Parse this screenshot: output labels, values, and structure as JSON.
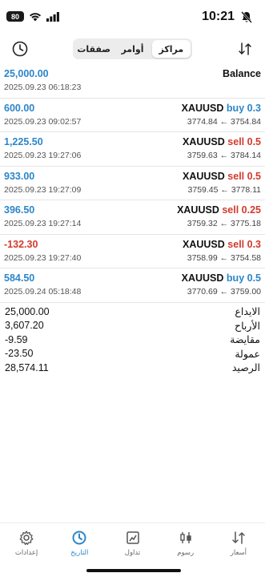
{
  "status_bar": {
    "battery": "80",
    "time": "10:21"
  },
  "segments": [
    {
      "label": "صفقات",
      "active": false
    },
    {
      "label": "أوامر",
      "active": false
    },
    {
      "label": "مراكز",
      "active": true
    }
  ],
  "balance_row": {
    "amount": "25,000.00",
    "date": "2025.09.23 06:18:23",
    "label": "Balance"
  },
  "trades": [
    {
      "profit": "600.00",
      "date": "2025.09.23 09:02:57",
      "symbol": "XAUUSD",
      "side": "buy 0.3",
      "prices": "3774.84 ← 3754.84"
    },
    {
      "profit": "1,225.50",
      "date": "2025.09.23 19:27:06",
      "symbol": "XAUUSD",
      "side": "sell 0.5",
      "prices": "3759.63 ← 3784.14"
    },
    {
      "profit": "933.00",
      "date": "2025.09.23 19:27:09",
      "symbol": "XAUUSD",
      "side": "sell 0.5",
      "prices": "3759.45 ← 3778.11"
    },
    {
      "profit": "396.50",
      "date": "2025.09.23 19:27:14",
      "symbol": "XAUUSD",
      "side": "sell 0.25",
      "prices": "3759.32 ← 3775.18"
    },
    {
      "profit": "-132.30",
      "date": "2025.09.23 19:27:40",
      "symbol": "XAUUSD",
      "side": "sell 0.3",
      "prices": "3758.99 ← 3754.58"
    },
    {
      "profit": "584.50",
      "date": "2025.09.24 05:18:48",
      "symbol": "XAUUSD",
      "side": "buy 0.5",
      "prices": "3770.69 ← 3759.00"
    }
  ],
  "summary": [
    {
      "value": "25,000.00",
      "label": "الايداع"
    },
    {
      "value": "3,607.20",
      "label": "الأرباح"
    },
    {
      "value": "-9.59",
      "label": "مقايضة"
    },
    {
      "value": "-23.50",
      "label": "عمولة"
    },
    {
      "value": "28,574.11",
      "label": "الرصيد"
    }
  ],
  "tabbar": [
    {
      "label": "إعدادات",
      "icon": "gear-icon",
      "active": false
    },
    {
      "label": "التاريخ",
      "icon": "history-icon",
      "active": true
    },
    {
      "label": "تداول",
      "icon": "trade-icon",
      "active": false
    },
    {
      "label": "رسوم",
      "icon": "chart-icon",
      "active": false
    },
    {
      "label": "أسعار",
      "icon": "quotes-icon",
      "active": false
    }
  ],
  "colors": {
    "positive": "#2b86c9",
    "negative": "#d33a2c",
    "active_tab": "#2b86c9"
  }
}
